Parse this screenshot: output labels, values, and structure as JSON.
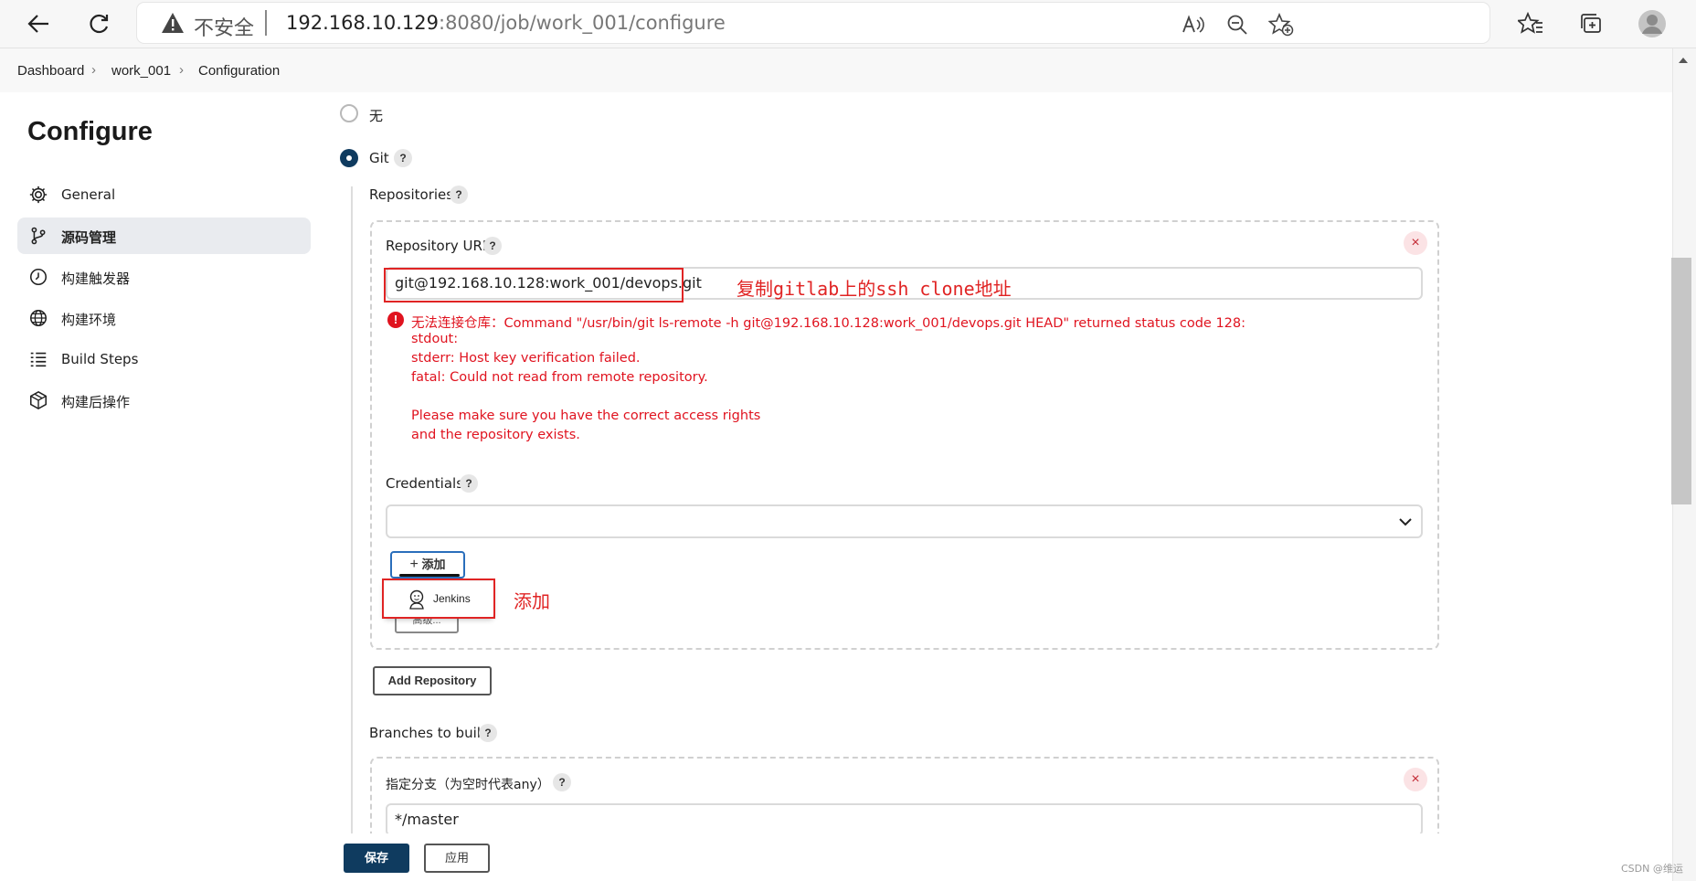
{
  "browser": {
    "insecure_label": "不安全",
    "url_host": "192.168.10.129",
    "url_rest": ":8080/job/work_001/configure"
  },
  "breadcrumb": [
    "Dashboard",
    "work_001",
    "Configuration"
  ],
  "sidebar": {
    "title": "Configure",
    "items": [
      {
        "label": "General"
      },
      {
        "label": "源码管理"
      },
      {
        "label": "构建触发器"
      },
      {
        "label": "构建环境"
      },
      {
        "label": "Build Steps"
      },
      {
        "label": "构建后操作"
      }
    ]
  },
  "scm": {
    "option_none": "无",
    "option_git": "Git",
    "repositories_label": "Repositories",
    "repo_url_label": "Repository URL",
    "repo_url_value": "git@192.168.10.128:work_001/devops.git",
    "annotation_url": "复制gitlab上的ssh clone地址",
    "error_lines": [
      "无法连接仓库：Command \"/usr/bin/git ls-remote -h git@192.168.10.128:work_001/devops.git HEAD\" returned status code 128:",
      "stdout:",
      "stderr: Host key verification failed.",
      "fatal: Could not read from remote repository.",
      "",
      "Please make sure you have the correct access rights",
      "and the repository exists."
    ],
    "credentials_label": "Credentials",
    "credentials_value": "",
    "add_button": "添加",
    "jenkins_item": "Jenkins",
    "advanced_button": "高级...",
    "annotation_add": "添加",
    "add_repository_button": "Add Repository",
    "branches_label": "Branches to build",
    "branch_specifier_label": "指定分支（为空时代表any）",
    "branch_value": "*/master",
    "help_glyph": "?",
    "remove_glyph": "×"
  },
  "footer": {
    "save": "保存",
    "apply": "应用"
  },
  "watermark": "CSDN @维运",
  "colors": {
    "primary": "#0f3b5f",
    "error": "#e0131f",
    "annotation": "#e02424"
  }
}
